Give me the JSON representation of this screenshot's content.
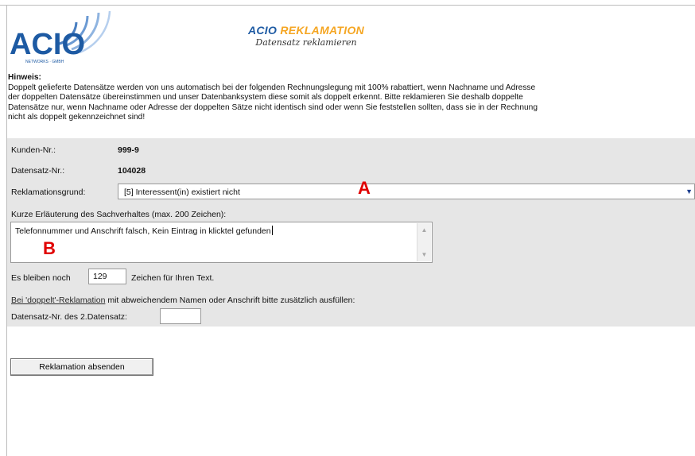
{
  "header": {
    "logo_text": "ACIO",
    "logo_subtext": "NETWORKS · GMBH",
    "title_brand": "ACIO",
    "title_main": "REKLAMATION",
    "subtitle": "Datensatz reklamieren"
  },
  "notice": {
    "heading": "Hinweis:",
    "lines": [
      "Doppelt gelieferte Datensätze werden von uns automatisch bei der folgenden Rechnungslegung mit 100% rabattiert, wenn Nachname und Adresse",
      "der doppelten Datensätze übereinstimmen und unser Datenbanksystem diese somit als doppelt erkennt. Bitte reklamieren Sie deshalb doppelte",
      "Datensätze nur, wenn Nachname oder Adresse der doppelten Sätze nicht identisch sind oder wenn Sie feststellen sollten, dass sie in der Rechnung",
      "nicht als doppelt gekennzeichnet sind!"
    ]
  },
  "form": {
    "kunden_label": "Kunden-Nr.:",
    "kunden_value": "999-9",
    "datensatz_label": "Datensatz-Nr.:",
    "datensatz_value": "104028",
    "grund_label": "Reklamationsgrund:",
    "grund_selected": "[5] Interessent(in) existiert nicht",
    "erlaeuterung_label": "Kurze Erläuterung des Sachverhaltes (max. 200 Zeichen):",
    "erlaeuterung_value": "Telefonnummer und Anschrift falsch, Kein Eintrag in klicktel gefunden",
    "remaining_prefix": "Es bleiben noch",
    "remaining_value": "129",
    "remaining_suffix": "Zeichen für Ihren Text.",
    "doppelt_link": "Bei 'doppelt'-Reklamation",
    "doppelt_text": " mit abweichendem Namen oder Anschrift bitte zusätzlich ausfüllen:",
    "second_label": "Datensatz-Nr. des 2.Datensatz:",
    "second_value": ""
  },
  "annotations": {
    "a": "A",
    "b": "B"
  },
  "submit_label": "Reklamation absenden",
  "colors": {
    "brand_blue": "#1d5aa3",
    "title_orange": "#f5a623",
    "form_bg": "#e6e6e6",
    "annotation_red": "#e00000"
  }
}
